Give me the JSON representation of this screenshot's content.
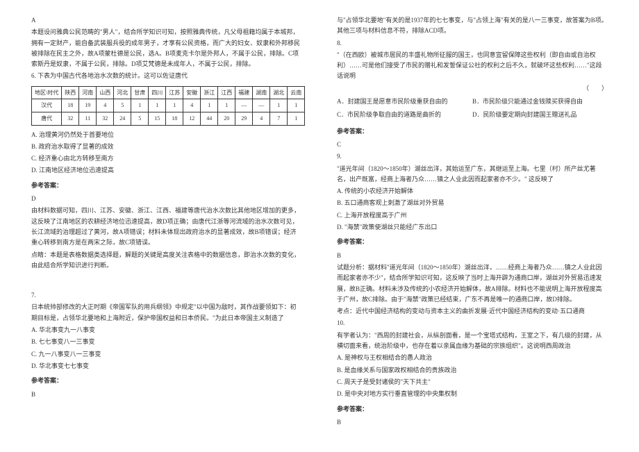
{
  "left": {
    "ans5_letter": "A",
    "ans5_p1": "本题设问雅典公民范畴的\"男人\"，结合所学知识可知，按照雅典传统，凡父母祖籍均属于本城邦，拥有一定财产，能自备武装服兵役的成年男子，才享有公民资格，而广大的妇女、奴隶和外邦移民被排除在民主之外，故A项蒙杜德是公民，选A。B项麦克卡尔是外邦人，不属于公民，排除。C项索斯丹是奴隶，不属于公民，排除。D项艾梵德是未成年人，不属于公民，排除。",
    "q6_stem": "6. 下表为中国古代各地治水次数的统计。这可以佐证唐代",
    "table": {
      "h1": "地区\\时代",
      "h2": "陕西",
      "h3": "河南",
      "h4": "山西",
      "h5": "河北",
      "h6": "甘肃",
      "h7": "四川",
      "h8": "江苏",
      "h9": "安徽",
      "h10": "浙江",
      "h11": "江西",
      "h12": "福建",
      "h13": "湖南",
      "h14": "湖北",
      "h15": "云南",
      "r1c0": "汉代",
      "r1": [
        "18",
        "19",
        "4",
        "5",
        "1",
        "1",
        "1",
        "4",
        "1",
        "1",
        "—",
        "—",
        "1",
        "1"
      ],
      "r2c0": "唐代",
      "r2": [
        "32",
        "11",
        "32",
        "24",
        "5",
        "15",
        "18",
        "12",
        "44",
        "20",
        "29",
        "4",
        "7",
        "1"
      ]
    },
    "q6_a": "A. 治理黄河仍然处于首要地位",
    "q6_b": "B. 政府治水取得了显著的成效",
    "q6_c": "C. 经济重心由北方转移至南方",
    "q6_d": "D. 江南地区经济地位迅速提高",
    "ans_label": "参考答案：",
    "ans6_letter": "D",
    "ans6_p1": "由材料数据可知，四川、江苏、安徽、浙江、江西、福建等唐代治水次数比其他地区增加的更多，这反映了江南地区的农耕经济地位迅速提高，故D项正确；由唐代江浙等河流域的治水次数可见，长江流域的治理超过了黄河，故A项错误；材料未体现出政府治水的显著成效，故B项错误；经济重心转移到南方是在两宋之际，故C项错误。",
    "ans6_p2": "点睛：本题是表格数据类选择题，解题的关键是高度关注表格中的数据信息，即治水次数的变化，由此结合所学知识进行判断。",
    "q7_stem": "日本统帅部修改的大正时期《帝国军队的用兵纲领》中规定\"以中国为敌时，其作战要领如下：初期目标是，占领华北要地和上海附近，保护帝国权益和日本侨民。\"为此日本帝国主义制造了",
    "q7_num": "7.",
    "q7_a": "A. 华北事变九一八事变",
    "q7_b": "B. 七七事变八一三事变",
    "q7_c": "C. 九一八事变八一三事变",
    "q7_d": "D. 华北事变七七事变",
    "ans7_letter": "B"
  },
  "right": {
    "ans7_p1": "与\"占领华北要地\"有关的是1937年的七七事变，与\"占领上海\"有关的是八一三事变，故答案为B项。其他三项与材料信息不符，排除ACD项。",
    "q8_num": "8.",
    "q8_stem": "\"（在西欧）被城市居民的丰盛礼物所征服的国王，也同意宣留保障这些权利（即自由或自治权利）……可是他们接受了市民的赠礼和发誓保证公社的权利之后不久，就破坏这些权利……\"这段话说明",
    "q8_blank": "（　　）",
    "q8_a": "A．封建国王是愿意市民阶级重获自由的",
    "q8_b": "B．市民阶级只能通过金钱赎买获得自由",
    "q8_c": "C．市民阶级争取自由的道路是曲折的",
    "q8_d": "D．民阶级要定期向封建国王赠送礼品",
    "ans8_letter": "C",
    "q9_num": "9.",
    "q9_stem": "\"道光年间（1820～1850年）湖丝出洋，其始运至广东，其继运至上海。七里（村）所产丝尤著名，出产既富，经商上海者乃众……镇之人业此因而起家者亦不少。\" 这反映了",
    "q9_a": "A. 传统的小农经济开始解体",
    "q9_b": "B. 五口通商客观上刺激了湖丝对外贸易",
    "q9_c": "C. 上海开放程度高于广州",
    "q9_d": "D. \"海禁\"政策使湖丝只能经广东出口",
    "ans9_letter": "B",
    "ans9_p1": "试题分析：据材料\"道光年间（1820～1850年）湖丝出洋，……经商上海者乃众……镇之人业此因而起家者亦不少\"，结合所学知识可知，这反映了当时上海开辟为通商口岸，湖丝对外贸易迅速发展，故B正确。材料未涉及传统的小农经济开始解体，故A排除。材料也不能说明上海开放程度高于广州，故C排除。由于\"海禁\"政策已经结束，广东不再是唯一的通商口岸，故D排除。",
    "ans9_p2": "考点：近代中国经济结构的变动与资本主义的曲折发展·近代中国经济结构的变动·五口通商",
    "q10_num": "10.",
    "q10_stem": "有学者认为：\"西周的封建社会，从纵剖面看，是一个宝塔式结构，王室之下，有几级的封建，从横切面来看，统治阶级中，也存在着以亲属血缘为基础的宗族组织\"。这说明西周政治",
    "q10_a": "A. 是神权与王权相结合的愚人政治",
    "q10_b": "B. 是血缘关系与国家政权相结合的贵族政治",
    "q10_c": "C. 周天子是受封诸侯的\"天下共主\"",
    "q10_d": "D. 是中央对地方实行垂直管理的中央集权制",
    "ans10_letter": "B",
    "ans_label": "参考答案："
  }
}
